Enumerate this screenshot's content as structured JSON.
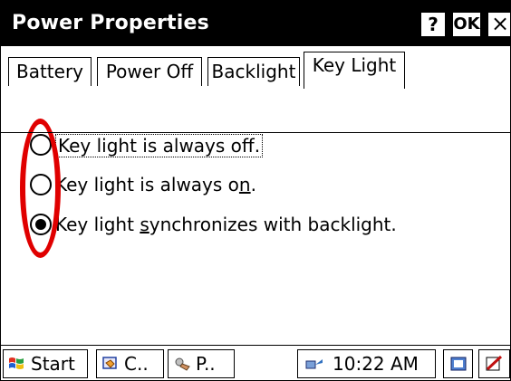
{
  "window": {
    "title": "Power Properties"
  },
  "titlebar_buttons": {
    "help": "?",
    "ok": "OK",
    "close": "×"
  },
  "tabs": [
    {
      "label": "Battery",
      "active": false
    },
    {
      "label": "Power Off",
      "active": false
    },
    {
      "label": "Backlight",
      "active": false
    },
    {
      "label": "Key Light",
      "active": true
    }
  ],
  "options": [
    {
      "prefix": "Key light is always of",
      "mnemonic": "f",
      "suffix": ".",
      "checked": false,
      "focused": true
    },
    {
      "prefix": "Key light is always o",
      "mnemonic": "n",
      "suffix": ".",
      "checked": false,
      "focused": false
    },
    {
      "prefix": "Key light ",
      "mnemonic": "s",
      "suffix": "ynchronizes with backlight.",
      "checked": true,
      "focused": false
    }
  ],
  "annotation": {
    "color": "#e00000"
  },
  "taskbar": {
    "start_label": "Start",
    "tasks": [
      {
        "label": "C.."
      },
      {
        "label": "P.."
      }
    ],
    "clock": "10:22 AM"
  },
  "icons": [
    "windows-flag-icon",
    "control-panel-icon",
    "power-plug-icon",
    "network-icon",
    "sync-icon",
    "edit-icon"
  ]
}
